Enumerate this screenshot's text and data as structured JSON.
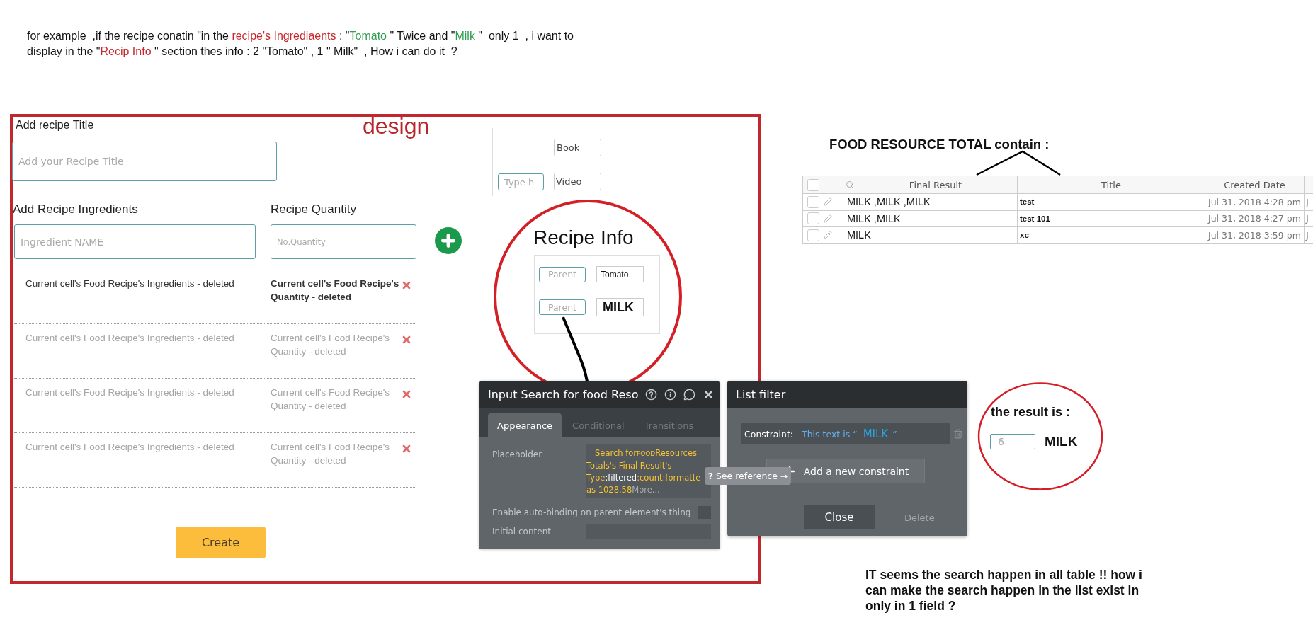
{
  "question": {
    "lines": [
      {
        "segments": [
          {
            "kind": "text",
            "text": "for example  ,if the recipe conatin \"in the "
          },
          {
            "kind": "term",
            "text": "recipe's Ingrediaents"
          },
          {
            "kind": "text",
            "text": " : \""
          },
          {
            "kind": "value",
            "text": "Tomato"
          },
          {
            "kind": "text",
            "text": " \" Twice and \""
          },
          {
            "kind": "value",
            "text": "Milk"
          },
          {
            "kind": "text",
            "text": " \"  only 1  , i want to"
          }
        ]
      },
      {
        "segments": [
          {
            "kind": "text",
            "text": "display in the \""
          },
          {
            "kind": "term",
            "text": "Recip Info"
          },
          {
            "kind": "text",
            "text": " \" section thes info : 2 \"Tomato\" , 1 \" Milk\"  , How i can do it  ?"
          }
        ]
      }
    ]
  },
  "design": {
    "label": "design",
    "title_label": "Add recipe Title",
    "title_placeholder": "Add your Recipe  Title",
    "ingredients_label": "Add Recipe Ingredients",
    "ingredients_placeholder": "Ingredient NAME",
    "quantity_label": "Recipe Quantity",
    "quantity_placeholder": "No.Quantity",
    "rows": [
      {
        "ingredient": "Current cell's Food Recipe's Ingredients - deleted",
        "quantity": "Current cell's Food Recipe's Quantity  - deleted",
        "dimmed": false
      },
      {
        "ingredient": "Current cell's Food Recipe's Ingredients - deleted",
        "quantity": "Current cell's Food Recipe's Quantity  - deleted",
        "dimmed": true
      },
      {
        "ingredient": "Current cell's Food Recipe's Ingredients - deleted",
        "quantity": "Current cell's Food Recipe's Quantity  - deleted",
        "dimmed": true
      },
      {
        "ingredient": "Current cell's Food Recipe's Ingredients - deleted",
        "quantity": "Current cell's Food Recipe's Quantity  - deleted",
        "dimmed": true
      }
    ],
    "create_button": "Create",
    "book_field": "Book",
    "video_field": "Video",
    "type_placeholder": "Type h",
    "recipe_info": {
      "title": "Recipe Info",
      "rows": [
        {
          "parent_placeholder": "Parent",
          "value": "Tomato",
          "kind": "plain"
        },
        {
          "parent_placeholder": "Parent",
          "value": "MILK",
          "kind": "bold"
        }
      ]
    }
  },
  "input_panel": {
    "title": "Input Search for food Reso",
    "tabs": [
      {
        "label": "Appearance",
        "selected": true
      },
      {
        "label": "Conditional",
        "selected": false
      },
      {
        "label": "Transitions",
        "selected": false
      }
    ],
    "placeholder_label": "Placeholder",
    "placeholder_lines": [
      {
        "segments": [
          {
            "kind": "expr",
            "text": "Search for"
          },
          {
            "kind": "small",
            "text": "FOOD"
          },
          {
            "kind": "expr",
            "text": "Resources"
          }
        ]
      },
      {
        "segments": [
          {
            "kind": "expr",
            "text": "Totals's Final Result's"
          }
        ]
      },
      {
        "segments": [
          {
            "kind": "expr",
            "text": "Type"
          },
          {
            "kind": "op",
            "text": ":filtered"
          },
          {
            "kind": "expr",
            "text": ":count:formatte"
          }
        ]
      },
      {
        "segments": [
          {
            "kind": "expr",
            "text": "as 1028.58"
          },
          {
            "kind": "more",
            "text": "More..."
          }
        ]
      }
    ],
    "auto_binding_label": "Enable auto-binding on parent element's thing",
    "auto_binding_checked": false,
    "initial_content_label": "Initial content"
  },
  "tooltip": {
    "icon": "?",
    "text": "See reference →"
  },
  "list_filter": {
    "title": "List filter",
    "constraint_label": "Constraint:",
    "constraint_prefix": "This text is “",
    "constraint_value": "MILK",
    "constraint_suffix": "”",
    "add_button": "Add a new constraint",
    "close_button": "Close",
    "delete_button": "Delete",
    "delete_disabled": true
  },
  "table": {
    "title": "FOOD RESOURCE TOTAL contain :",
    "select_all_checked": false,
    "columns": [
      "Final Result",
      "Title",
      "Created Date"
    ],
    "rows": [
      {
        "checked": false,
        "final_result": "MILK ,MILK ,MILK",
        "title": "test",
        "created_date": "Jul 31, 2018 4:28 pm",
        "column_4": "J"
      },
      {
        "checked": false,
        "final_result": "MILK ,MILK",
        "title": "test 101",
        "created_date": "Jul 31, 2018 4:27 pm",
        "column_4": "J"
      },
      {
        "checked": false,
        "final_result": "MILK",
        "title": "xc",
        "created_date": "Jul 31, 2018 3:59 pm",
        "column_4": "J"
      }
    ]
  },
  "result": {
    "label": "the result is :",
    "count": "6",
    "value": "MILK"
  },
  "footer_note": "IT seems the search happen in all table !! how i can make the search happen in the list exist in only in 1 field  ?"
}
